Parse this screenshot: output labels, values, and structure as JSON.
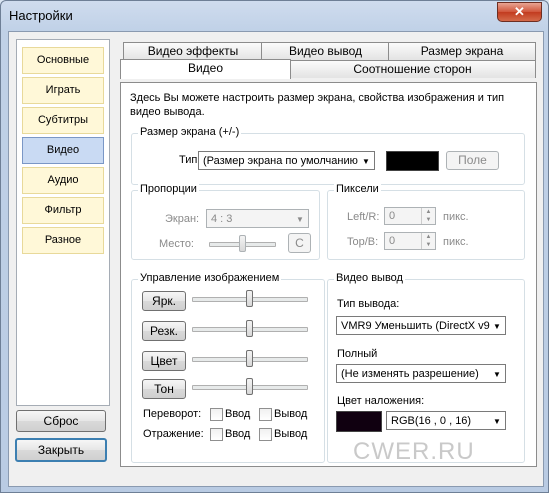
{
  "window": {
    "title": "Настройки",
    "close": "✕"
  },
  "sidebar": {
    "items": [
      {
        "label": "Основные"
      },
      {
        "label": "Играть"
      },
      {
        "label": "Субтитры"
      },
      {
        "label": "Видео"
      },
      {
        "label": "Аудио"
      },
      {
        "label": "Фильтр"
      },
      {
        "label": "Разное"
      }
    ],
    "active": "Видео"
  },
  "buttons": {
    "reset": "Сброс",
    "close": "Закрыть"
  },
  "tabs": {
    "row1": [
      "Видео эффекты",
      "Видео вывод",
      "Размер экрана"
    ],
    "row2": [
      "Видео",
      "Соотношение сторон"
    ],
    "active": "Видео"
  },
  "description": "Здесь Вы можете настроить размер экрана, свойства изображения и тип видео вывода.",
  "screen_size": {
    "group_title": "Размер экрана (+/-)",
    "type_label": "Тип:",
    "type_value": "(Размер экрана по умолчанию",
    "field_button": "Поле",
    "color": "#000000"
  },
  "proportions": {
    "group_title": "Пропорции",
    "screen_label": "Экран:",
    "screen_value": "4 : 3",
    "place_label": "Место:",
    "place_button": "C"
  },
  "pixels": {
    "group_title": "Пиксели",
    "left_label": "Left/R:",
    "left_value": "0",
    "left_unit": "пикс.",
    "top_label": "Top/B:",
    "top_value": "0",
    "top_unit": "пикс."
  },
  "image_control": {
    "group_title": "Управление изображением",
    "sliders": [
      {
        "label": "Ярк.",
        "level": 0.5
      },
      {
        "label": "Резк.",
        "level": 0.5
      },
      {
        "label": "Цвет",
        "level": 0.5
      },
      {
        "label": "Тон",
        "level": 0.5
      }
    ],
    "flip_label": "Переворот:",
    "mirror_label": "Отражение:",
    "input_label": "Ввод",
    "output_label": "Вывод"
  },
  "video_output": {
    "group_title": "Видео вывод",
    "type_label": "Тип вывода:",
    "type_value": "VMR9 Уменьшить (DirectX v9",
    "full_label": "Полный",
    "full_value": "(Не изменять разрешение)",
    "overlay_label": "Цвет наложения:",
    "overlay_value": "RGB(16 , 0 , 16)",
    "overlay_color": "#100010"
  },
  "watermark": "CWER.RU"
}
